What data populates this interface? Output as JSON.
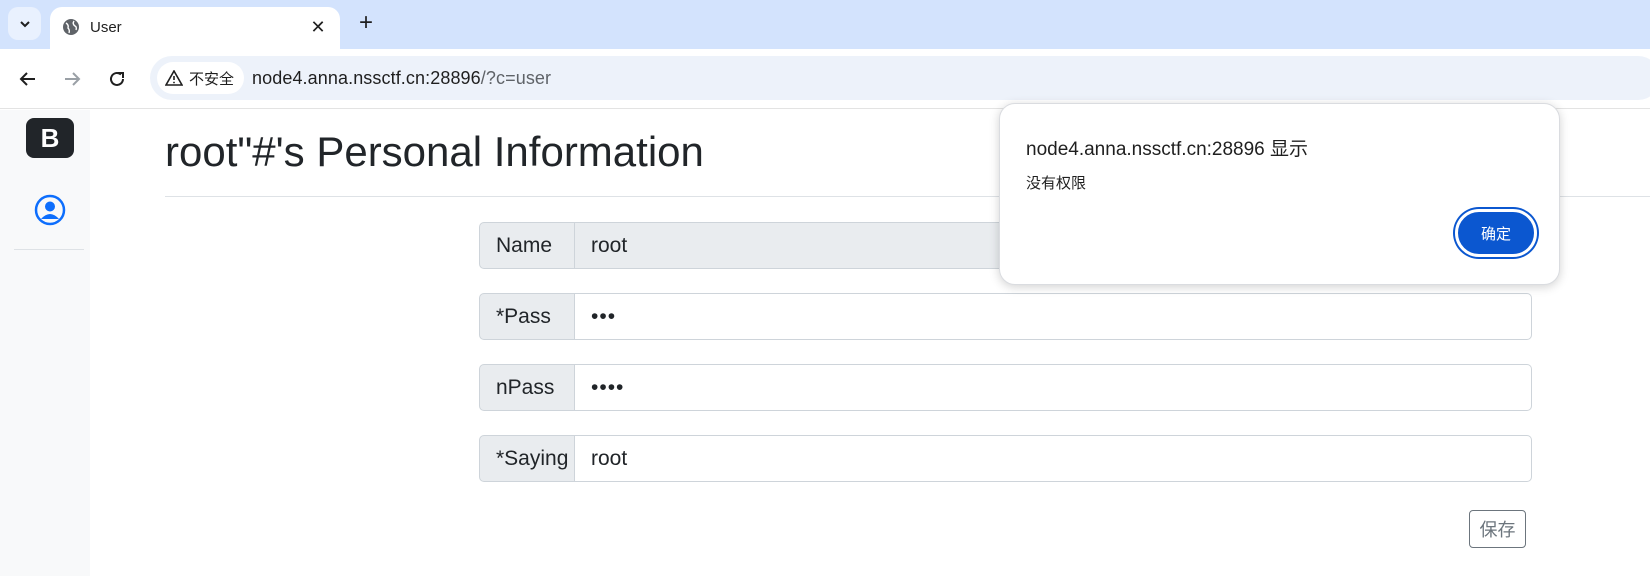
{
  "browser": {
    "tab": {
      "title": "User",
      "close_label": "✕"
    },
    "new_tab_label": "+",
    "omnibox": {
      "security_label": "不安全",
      "url_host": "node4.anna.nssctf.cn:28896",
      "url_path": "/?c=user"
    }
  },
  "sidebar": {
    "brand_label": "B"
  },
  "page": {
    "title": "root\"#'s Personal Information",
    "fields": [
      {
        "label": "Name",
        "value": "root"
      },
      {
        "label": "*Pass",
        "value": "•••"
      },
      {
        "label": "nPass",
        "value": "••••"
      },
      {
        "label": "*Saying",
        "value": "root"
      }
    ],
    "save_label": "保存"
  },
  "dialog": {
    "title": "node4.anna.nssctf.cn:28896 显示",
    "message": "没有权限",
    "ok_label": "确定"
  },
  "colors": {
    "tabstrip_bg": "#d3e3fd",
    "omnibox_bg": "#edf2fa",
    "dialog_button": "#0b57d0",
    "brand": "#212529",
    "user_icon": "#0d6efd"
  }
}
